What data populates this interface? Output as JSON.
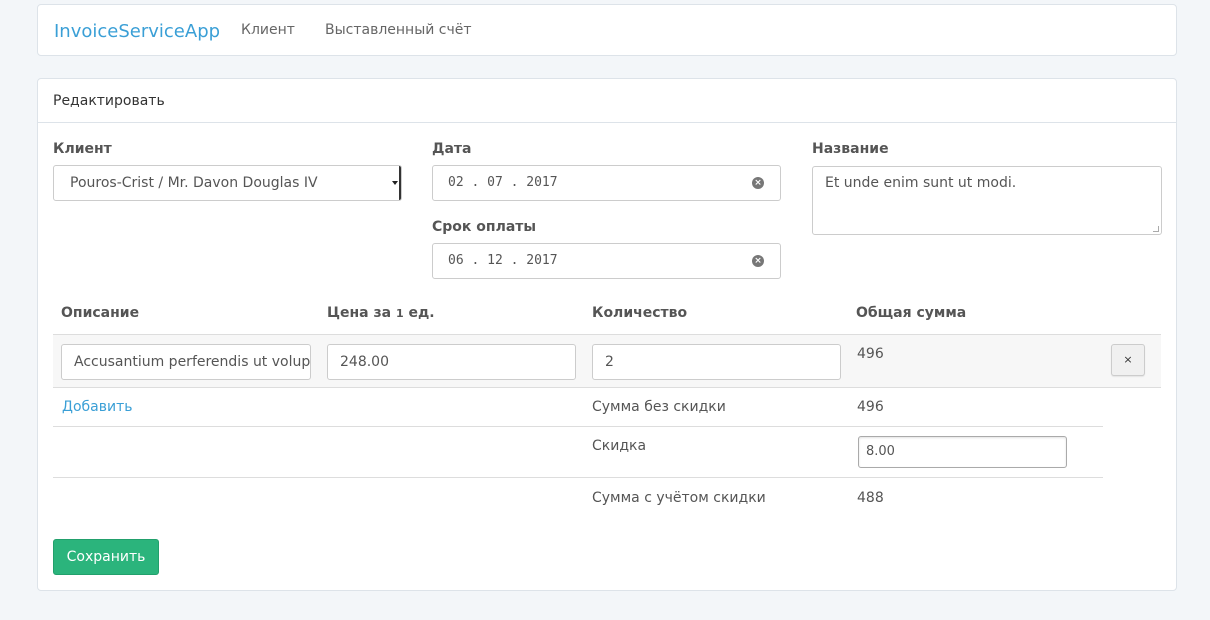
{
  "navbar": {
    "brand": "InvoiceServiceApp",
    "links": [
      "Клиент",
      "Выставленный счёт"
    ]
  },
  "panel": {
    "title": "Редактировать"
  },
  "form": {
    "client_label": "Клиент",
    "client_value": "Pouros-Crist / Mr. Davon Douglas IV",
    "date_label": "Дата",
    "date_value": "02 . 07 . 2017",
    "due_label": "Срок оплаты",
    "due_value": "06 . 12 . 2017",
    "name_label": "Название",
    "name_value": "Et unde enim sunt ut modi."
  },
  "table": {
    "headers": {
      "description": "Описание",
      "price_prefix": "Цена за",
      "price_one": "1",
      "price_suffix": "ед.",
      "quantity": "Количество",
      "total": "Общая сумма"
    },
    "rows": [
      {
        "description": "Accusantium perferendis ut voluptatem",
        "price": "248.00",
        "quantity": "2",
        "total": "496",
        "remove": "×"
      }
    ]
  },
  "summary": {
    "add_link": "Добавить",
    "subtotal_label": "Сумма без скидки",
    "subtotal_value": "496",
    "discount_label": "Скидка",
    "discount_value": "8.00",
    "total_label": "Сумма с учётом скидки",
    "total_value": "488"
  },
  "actions": {
    "save": "Сохранить"
  },
  "colors": {
    "brand": "#3a9fd6",
    "save_button": "#2bb47c",
    "page_bg": "#f3f6f9"
  }
}
